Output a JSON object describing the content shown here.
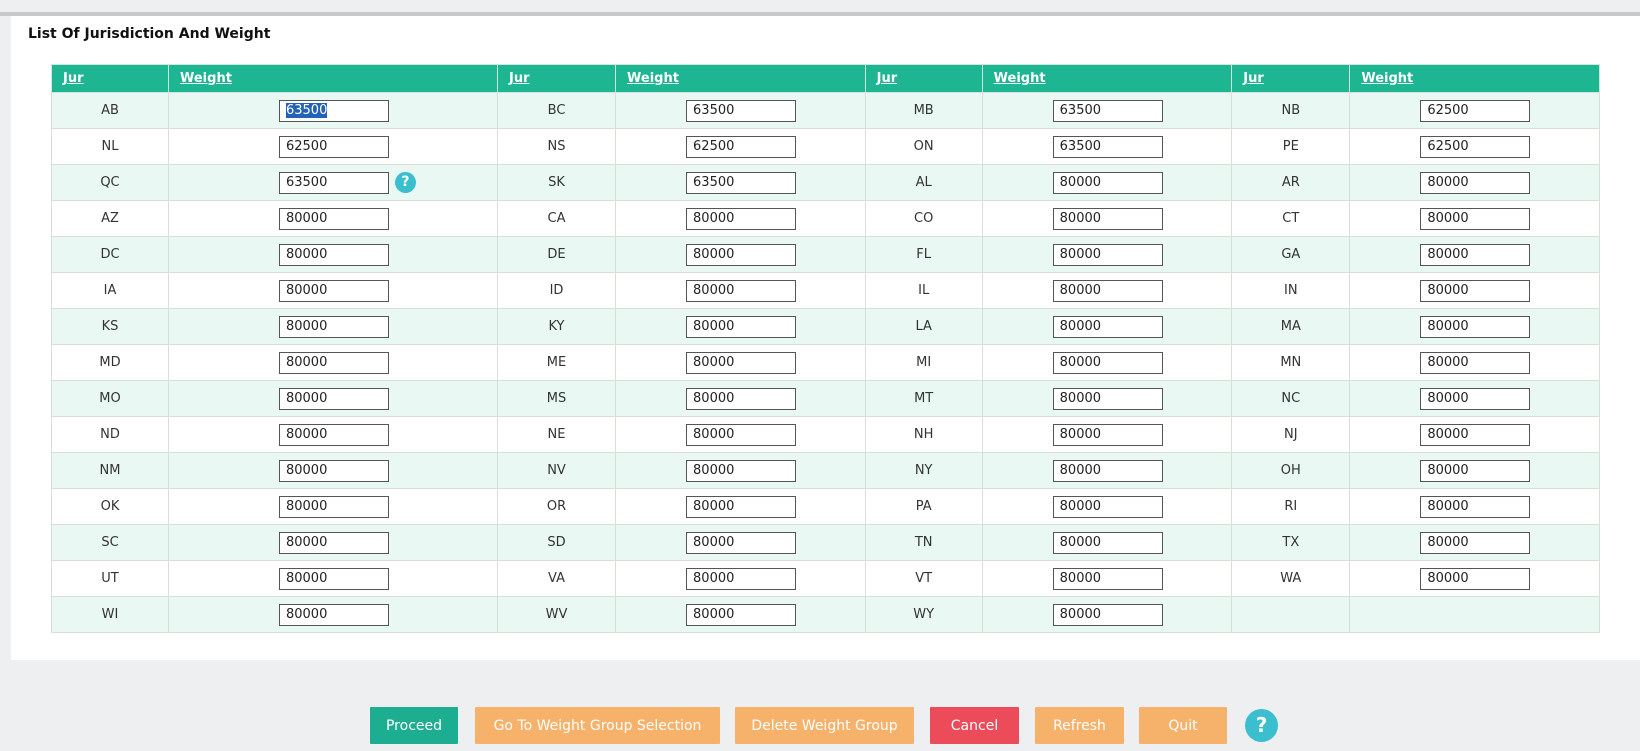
{
  "panel": {
    "title": "List Of Jurisdiction And Weight"
  },
  "table": {
    "headers": [
      "Jur",
      "Weight",
      "Jur",
      "Weight",
      "Jur",
      "Weight",
      "Jur",
      "Weight"
    ],
    "rows": [
      [
        [
          "AB",
          "63500"
        ],
        [
          "BC",
          "63500"
        ],
        [
          "MB",
          "63500"
        ],
        [
          "NB",
          "62500"
        ]
      ],
      [
        [
          "NL",
          "62500"
        ],
        [
          "NS",
          "62500"
        ],
        [
          "ON",
          "63500"
        ],
        [
          "PE",
          "62500"
        ]
      ],
      [
        [
          "QC",
          "63500"
        ],
        [
          "SK",
          "63500"
        ],
        [
          "AL",
          "80000"
        ],
        [
          "AR",
          "80000"
        ]
      ],
      [
        [
          "AZ",
          "80000"
        ],
        [
          "CA",
          "80000"
        ],
        [
          "CO",
          "80000"
        ],
        [
          "CT",
          "80000"
        ]
      ],
      [
        [
          "DC",
          "80000"
        ],
        [
          "DE",
          "80000"
        ],
        [
          "FL",
          "80000"
        ],
        [
          "GA",
          "80000"
        ]
      ],
      [
        [
          "IA",
          "80000"
        ],
        [
          "ID",
          "80000"
        ],
        [
          "IL",
          "80000"
        ],
        [
          "IN",
          "80000"
        ]
      ],
      [
        [
          "KS",
          "80000"
        ],
        [
          "KY",
          "80000"
        ],
        [
          "LA",
          "80000"
        ],
        [
          "MA",
          "80000"
        ]
      ],
      [
        [
          "MD",
          "80000"
        ],
        [
          "ME",
          "80000"
        ],
        [
          "MI",
          "80000"
        ],
        [
          "MN",
          "80000"
        ]
      ],
      [
        [
          "MO",
          "80000"
        ],
        [
          "MS",
          "80000"
        ],
        [
          "MT",
          "80000"
        ],
        [
          "NC",
          "80000"
        ]
      ],
      [
        [
          "ND",
          "80000"
        ],
        [
          "NE",
          "80000"
        ],
        [
          "NH",
          "80000"
        ],
        [
          "NJ",
          "80000"
        ]
      ],
      [
        [
          "NM",
          "80000"
        ],
        [
          "NV",
          "80000"
        ],
        [
          "NY",
          "80000"
        ],
        [
          "OH",
          "80000"
        ]
      ],
      [
        [
          "OK",
          "80000"
        ],
        [
          "OR",
          "80000"
        ],
        [
          "PA",
          "80000"
        ],
        [
          "RI",
          "80000"
        ]
      ],
      [
        [
          "SC",
          "80000"
        ],
        [
          "SD",
          "80000"
        ],
        [
          "TN",
          "80000"
        ],
        [
          "TX",
          "80000"
        ]
      ],
      [
        [
          "UT",
          "80000"
        ],
        [
          "VA",
          "80000"
        ],
        [
          "VT",
          "80000"
        ],
        [
          "WA",
          "80000"
        ]
      ],
      [
        [
          "WI",
          "80000"
        ],
        [
          "WV",
          "80000"
        ],
        [
          "WY",
          "80000"
        ],
        null
      ]
    ],
    "selected_value": "63500",
    "qc_help_icon": "?"
  },
  "buttons": {
    "proceed": "Proceed",
    "go_to_weight_group": "Go To Weight Group Selection",
    "delete_weight_group": "Delete Weight Group",
    "cancel": "Cancel",
    "refresh": "Refresh",
    "quit": "Quit",
    "help": "?"
  },
  "colors": {
    "header_bg": "#1db592",
    "row_alt_bg": "#e9f8f3",
    "proceed": "#1dae92",
    "secondary": "#f6b26b",
    "cancel": "#ec4b5a",
    "help": "#3bbfcf",
    "selection": "#2462b8"
  }
}
